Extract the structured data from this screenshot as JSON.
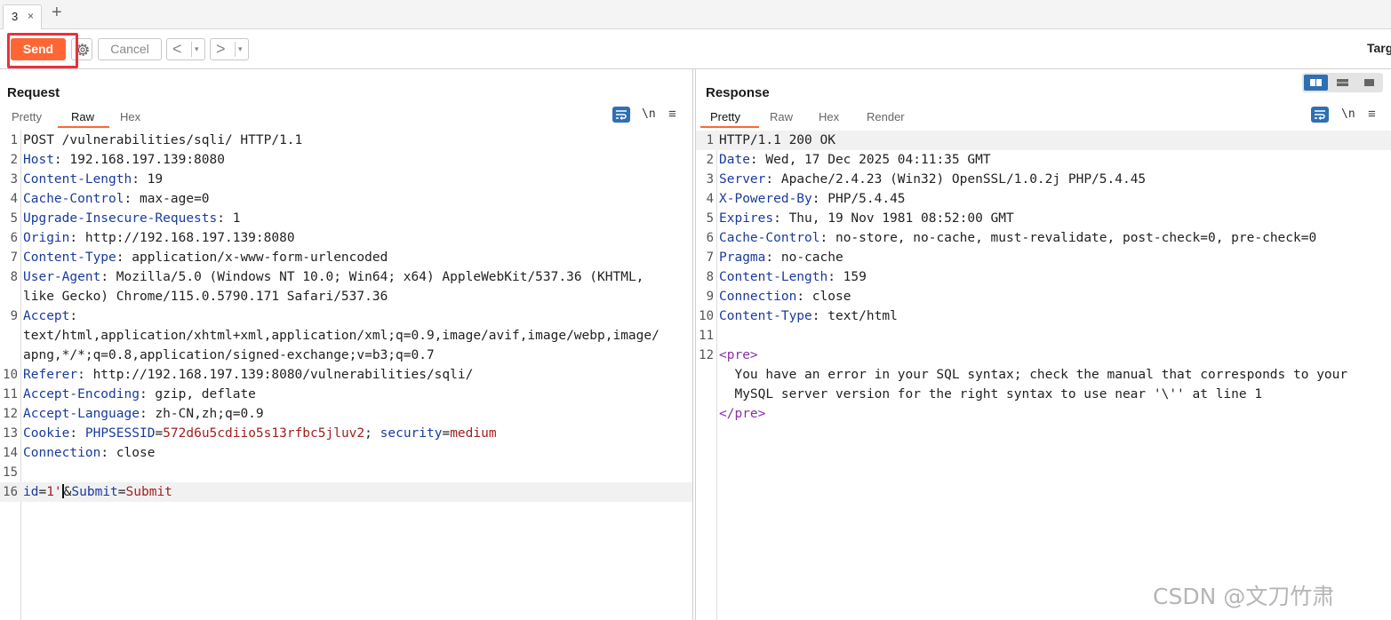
{
  "tab": {
    "label": "3",
    "close": "×",
    "add": "+"
  },
  "toolbar": {
    "send_label": "Send",
    "cancel_label": "Cancel",
    "back_arrow": "<",
    "forward_arrow": ">",
    "dropdown": "▾",
    "target_label": "Targ"
  },
  "request": {
    "title": "Request",
    "tabs": [
      "Pretty",
      "Raw",
      "Hex"
    ],
    "active_tab": "Raw",
    "newline_icon": "\\n",
    "menu_icon": "≡",
    "lines": [
      {
        "n": "1",
        "text": "POST /vulnerabilities/sqli/ HTTP/1.1"
      },
      {
        "n": "2",
        "key": "Host",
        "val": " 192.168.197.139:8080"
      },
      {
        "n": "3",
        "key": "Content-Length",
        "val": " 19"
      },
      {
        "n": "4",
        "key": "Cache-Control",
        "val": " max-age=0"
      },
      {
        "n": "5",
        "key": "Upgrade-Insecure-Requests",
        "val": " 1"
      },
      {
        "n": "6",
        "key": "Origin",
        "val": " http://192.168.197.139:8080"
      },
      {
        "n": "7",
        "key": "Content-Type",
        "val": " application/x-www-form-urlencoded"
      },
      {
        "n": "8",
        "key": "User-Agent",
        "val": " Mozilla/5.0 (Windows NT 10.0; Win64; x64) AppleWebKit/537.36 (KHTML,"
      },
      {
        "n": "",
        "text": "like Gecko) Chrome/115.0.5790.171 Safari/537.36"
      },
      {
        "n": "9",
        "key": "Accept",
        "val": ""
      },
      {
        "n": "",
        "text": "text/html,application/xhtml+xml,application/xml;q=0.9,image/avif,image/webp,image/"
      },
      {
        "n": "",
        "text": "apng,*/*;q=0.8,application/signed-exchange;v=b3;q=0.7"
      },
      {
        "n": "10",
        "key": "Referer",
        "val": " http://192.168.197.139:8080/vulnerabilities/sqli/"
      },
      {
        "n": "11",
        "key": "Accept-Encoding",
        "val": " gzip, deflate"
      },
      {
        "n": "12",
        "key": "Accept-Language",
        "val": " zh-CN,zh;q=0.9"
      },
      {
        "n": "13",
        "cookie": true,
        "key": "Cookie",
        "c1k": "PHPSESSID",
        "c1v": "572d6u5cdiio5s13rfbc5jluv2",
        "sep": "; ",
        "c2k": "security",
        "c2v": "medium"
      },
      {
        "n": "14",
        "key": "Connection",
        "val": " close"
      },
      {
        "n": "15",
        "text": ""
      },
      {
        "n": "16",
        "body": true,
        "p1k": "id",
        "p1v": "1'",
        "amp": "&",
        "p2k": "Submit",
        "p2v": "Submit"
      }
    ]
  },
  "response": {
    "title": "Response",
    "tabs": [
      "Pretty",
      "Raw",
      "Hex",
      "Render"
    ],
    "active_tab": "Pretty",
    "newline_icon": "\\n",
    "menu_icon": "≡",
    "lines": [
      {
        "n": "1",
        "text": "HTTP/1.1 200 OK"
      },
      {
        "n": "2",
        "key": "Date",
        "val": " Wed, 17 Dec 2025 04:11:35 GMT"
      },
      {
        "n": "3",
        "key": "Server",
        "val": " Apache/2.4.23 (Win32) OpenSSL/1.0.2j PHP/5.4.45"
      },
      {
        "n": "4",
        "key": "X-Powered-By",
        "val": " PHP/5.4.45"
      },
      {
        "n": "5",
        "key": "Expires",
        "val": " Thu, 19 Nov 1981 08:52:00 GMT"
      },
      {
        "n": "6",
        "key": "Cache-Control",
        "val": " no-store, no-cache, must-revalidate, post-check=0, pre-check=0"
      },
      {
        "n": "7",
        "key": "Pragma",
        "val": " no-cache"
      },
      {
        "n": "8",
        "key": "Content-Length",
        "val": " 159"
      },
      {
        "n": "9",
        "key": "Connection",
        "val": " close"
      },
      {
        "n": "10",
        "key": "Content-Type",
        "val": " text/html"
      },
      {
        "n": "11",
        "text": ""
      },
      {
        "n": "12",
        "tag": "<pre>"
      },
      {
        "n": "",
        "text": "  You have an error in your SQL syntax; check the manual that corresponds to your"
      },
      {
        "n": "",
        "text": "  MySQL server version for the right syntax to use near '\\'' at line 1"
      },
      {
        "n": "",
        "tag": "</pre>"
      }
    ]
  },
  "watermark": "CSDN @文刀竹肃",
  "colors": {
    "accent": "#ff6633",
    "highlight_box": "#e8323c",
    "header_key": "#1a3b9c",
    "cookie_value": "#a12020",
    "tag": "#8a2fa8",
    "toggle_active": "#2f6fb3"
  }
}
